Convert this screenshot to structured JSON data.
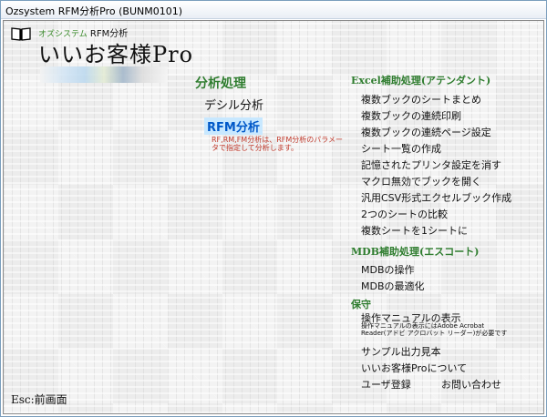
{
  "window": {
    "title": "Ozsystem RFM分析Pro (BUNM0101)"
  },
  "brand": {
    "icon": "book-icon",
    "sub_green": "オズシステム",
    "sub_text": "RFM分析",
    "name": "いいお客様Pro"
  },
  "analysis": {
    "heading": "分析処理",
    "items": [
      {
        "label": "デシル分析",
        "selected": false
      },
      {
        "label": "RFM分析",
        "selected": true
      }
    ],
    "description": "RF,RM,FM分析は、RFM分析のパラメータで指定して分析します。"
  },
  "excel": {
    "heading": "Excel補助処理(アテンダント)",
    "items": [
      "複数ブックのシートまとめ",
      "複数ブックの連続印刷",
      "複数ブックの連続ページ設定",
      "シート一覧の作成",
      "記憶されたプリンタ設定を消す",
      "マクロ無効でブックを開く",
      "汎用CSV形式エクセルブック作成",
      "2つのシートの比較",
      "複数シートを1シートに"
    ]
  },
  "mdb": {
    "heading": "MDB補助処理(エスコート)",
    "items": [
      "MDBの操作",
      "MDBの最適化"
    ]
  },
  "maintenance": {
    "heading": "保守",
    "manual": "操作マニュアルの表示",
    "manual_note": "操作マニュアルの表示にはAdobe Acrobat Reader(アドビ アクロバット リーダー)が必要です",
    "sample": "サンプル出力見本",
    "about": "いいお客様Proについて",
    "register": "ユーザ登録",
    "contact": "お問い合わせ"
  },
  "footer": {
    "esc": "Esc:前画面"
  },
  "colors": {
    "heading_green": "#2f7d2f",
    "selected_blue": "#0058c8",
    "note_red": "#c0392b"
  }
}
